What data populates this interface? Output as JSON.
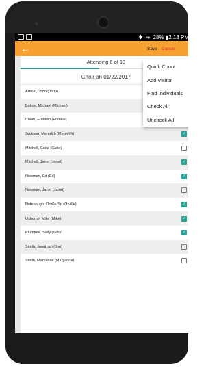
{
  "status_bar": {
    "right_text": "28% ▮2:18 PM",
    "icons": [
      "sd-card-icon",
      "image-icon",
      "bluetooth-icon",
      "wifi-icon"
    ]
  },
  "appbar": {
    "back_icon": "arrow-left-icon",
    "save_label": "Save",
    "cancel_label": "Cancel",
    "more_icon": "more-vert-icon",
    "color": "#f7a132"
  },
  "attendance": {
    "text": "Attending 6 of 13",
    "progress_fraction": 0.46
  },
  "group_title": "Choir on 01/22/2017",
  "menu": {
    "items": [
      "Quick Count",
      "Add Visitor",
      "Find Individuals",
      "Check All",
      "Uncheck All"
    ]
  },
  "people": [
    {
      "name": "Arnold, John (John)",
      "checked": false
    },
    {
      "name": "Bolton, Michael (Michael)",
      "checked": false
    },
    {
      "name": "Clean, Franklin (Frankie)",
      "checked": false
    },
    {
      "name": "Jackson, Meredith (Meredith)",
      "checked": true
    },
    {
      "name": "Mitchell, Carla (Carla)",
      "checked": false
    },
    {
      "name": "Mitchell, Janet (Janet)",
      "checked": true
    },
    {
      "name": "Newman, Ed (Ed)",
      "checked": true
    },
    {
      "name": "Newman, Janet (Janet)",
      "checked": false
    },
    {
      "name": "Notenough, Orville Sr. (Orville)",
      "checked": true
    },
    {
      "name": "Usborne, Mike (Mike)",
      "checked": true
    },
    {
      "name": "Plumtree, Sally (Sally)",
      "checked": true
    },
    {
      "name": "Smith, Jonathan (Jon)",
      "checked": false
    },
    {
      "name": "Smith, Maryanne (Maryanne)",
      "checked": false
    }
  ],
  "colors": {
    "accent": "#f7a132",
    "check": "#26a69a",
    "cancel": "#d32f2f"
  }
}
